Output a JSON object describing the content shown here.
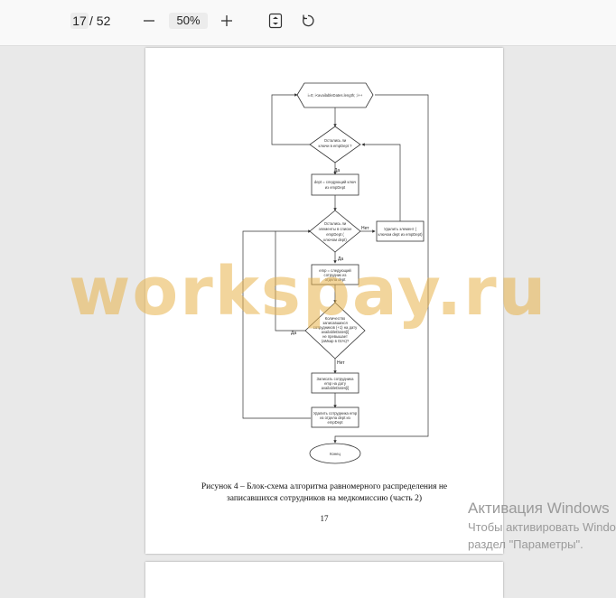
{
  "toolbar": {
    "current_page": "17",
    "total_pages": "/ 52",
    "zoom": "50%"
  },
  "icons": [
    "zoom-out-icon",
    "zoom-in-icon",
    "fit-page-icon",
    "rotate-icon"
  ],
  "document": {
    "flowchart": {
      "loop_start": "i=0; i<availableDates.length; ;i++",
      "d1": [
        "Остались ли",
        "ключи в empDept ?"
      ],
      "p1": [
        "dept = следующий ключ",
        "из empDept"
      ],
      "d2": [
        "Остались ли",
        "элементы в списке",
        "empDept (",
        "ключом dept)"
      ],
      "p_right": [
        "Удалить элемент (",
        "ключом dept из empDept)"
      ],
      "p2": [
        "emp = следующий",
        "сотрудник из",
        "отдела dept"
      ],
      "d3": [
        "Количество",
        "записавшихся",
        "сотрудников (+1) на дату",
        "availableDates[i]",
        "не превышает",
        "(aМкap в 01%)?"
      ],
      "p3": [
        "Записать сотрудника",
        "emp на дату",
        "availableDates[i]"
      ],
      "p4": [
        "Удалить сотрудника emp",
        "из отдела dept из",
        "empDept"
      ],
      "end": "Конец",
      "label_yes": "Да",
      "label_no": "Нет"
    },
    "caption_line1": "Рисунок 4 – Блок-схема алгоритма равномерного распределения не",
    "caption_line2": "записавшихся сотрудников на медкомиссию (часть 2)",
    "page_number": "17"
  },
  "watermark": "workspay.ru",
  "activation": {
    "title": "Активация Windows",
    "line1": "Чтобы активировать Windows,",
    "line2": "раздел \"Параметры\"."
  }
}
